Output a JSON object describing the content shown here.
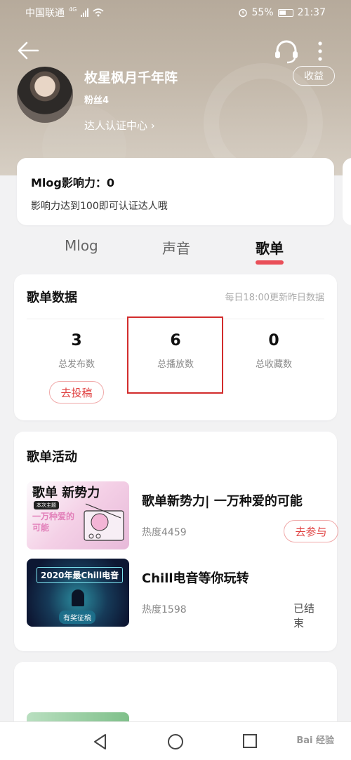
{
  "status_bar": {
    "carrier": "中国联通",
    "network": "4G",
    "battery": "55%",
    "time": "21:37"
  },
  "profile": {
    "nickname": "枚星枫月千年阵",
    "fans": "粉丝4",
    "talent_link": "达人认证中心 ›",
    "income_button": "收益"
  },
  "influence": {
    "title": "Mlog影响力：0",
    "hint": "影响力达到100即可认证达人哦"
  },
  "tabs": [
    {
      "label": "Mlog",
      "active": false
    },
    {
      "label": "声音",
      "active": false
    },
    {
      "label": "歌单",
      "active": true
    }
  ],
  "playlist_data": {
    "title": "歌单数据",
    "note": "每日18:00更新昨日数据",
    "stats": [
      {
        "value": "3",
        "label": "总发布数"
      },
      {
        "value": "6",
        "label": "总播放数"
      },
      {
        "value": "0",
        "label": "总收藏数"
      }
    ],
    "submit_button": "去投稿"
  },
  "activities": {
    "title": "歌单活动",
    "items": [
      {
        "name": "歌单新势力| 一万种爱的可能",
        "heat": "热度4459",
        "action": "去参与",
        "thumb_title": "歌单 新势力",
        "thumb_badge": "本次主题",
        "thumb_sub": "一万种爱的可能"
      },
      {
        "name": "Chill电音等你玩转",
        "heat": "热度1598",
        "status": "已结束",
        "thumb_title": "2020年最Chill电音",
        "thumb_badge": "有奖征稿"
      }
    ]
  },
  "watermark": "Bai 经验",
  "colors": {
    "accent": "#e8333c",
    "hero": "#b6aa9b"
  }
}
